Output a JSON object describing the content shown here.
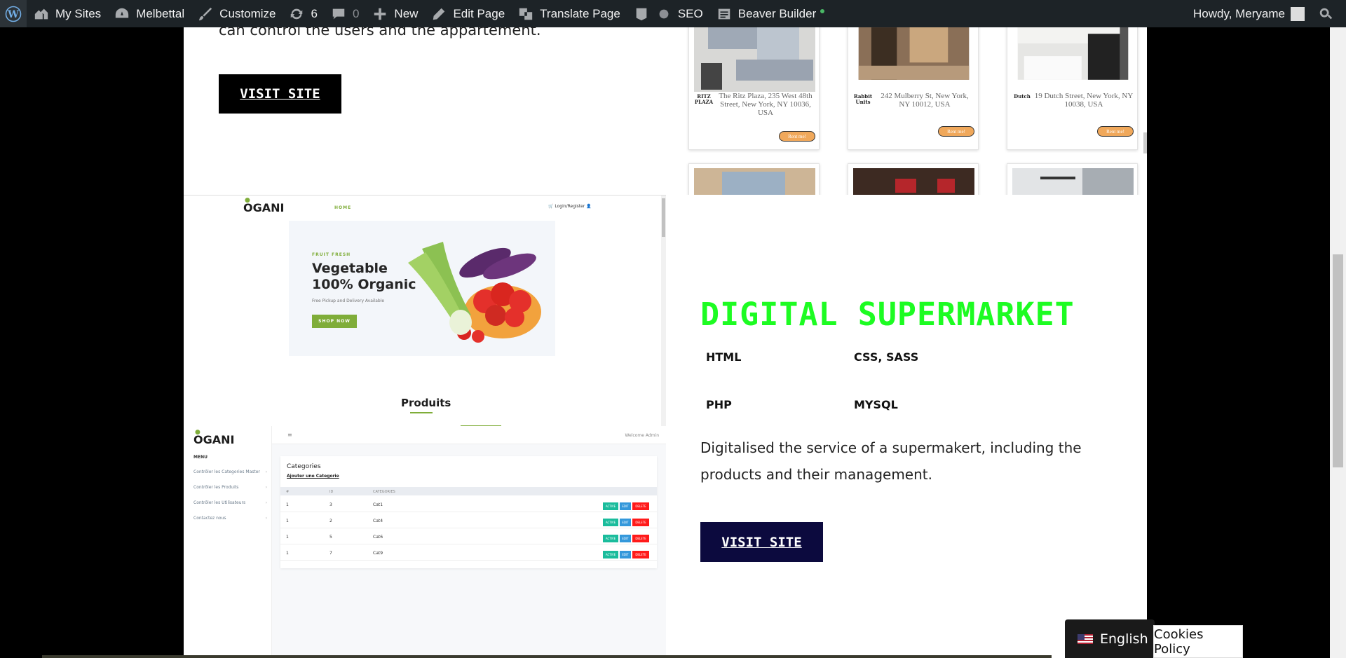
{
  "adminbar": {
    "items": [
      {
        "label": "My Sites"
      },
      {
        "label": "Melbettal"
      },
      {
        "label": "Customize"
      },
      {
        "label": "6"
      },
      {
        "label": "0"
      },
      {
        "label": "New"
      },
      {
        "label": "Edit Page"
      },
      {
        "label": "Translate Page"
      },
      {
        "label": "SEO"
      },
      {
        "label": "Beaver Builder"
      }
    ],
    "greeting": "Howdy, Meryame"
  },
  "top_section": {
    "partial_text": "can control the users and the appartement.",
    "visit_label": "VISIT SITE"
  },
  "apartments": [
    {
      "name": "RITZ PLAZA",
      "address": "The Ritz Plaza, 235 West 48th Street, New York, NY 10036, USA",
      "button": "Rent me!"
    },
    {
      "name": "Rabbit Units",
      "address": "242 Mulberry St, New York, NY 10012, USA",
      "button": "Rent me!"
    },
    {
      "name": "Dutch",
      "address": "19 Dutch Street, New York, NY 10038, USA",
      "button": "Rent me!"
    }
  ],
  "ogani": {
    "logo": "OGANI",
    "home": "HOME",
    "login": "Login/Register",
    "hero_tag": "FRUIT FRESH",
    "hero_title": "Vegetable 100% Organic",
    "hero_sub": "Free Pickup and Delivery Available",
    "hero_btn": "SHOP NOW",
    "section_title": "Produits"
  },
  "ogani_admin": {
    "logo": "OGANI",
    "welcome": "Welcome Admin",
    "menu_title": "MENU",
    "menu_items": [
      "Contrôler les Categories Master",
      "Contrôler les Produits",
      "Contrôler les Utilisateurs",
      "Contactez nous"
    ],
    "card_title": "Categories",
    "add_link": "Ajouter une Categorie",
    "headers": [
      "#",
      "ID",
      "CATEGORIES"
    ],
    "rows": [
      {
        "n": "1",
        "id": "3",
        "cat": "Cat1"
      },
      {
        "n": "1",
        "id": "2",
        "cat": "Cat4"
      },
      {
        "n": "1",
        "id": "5",
        "cat": "Cat6"
      },
      {
        "n": "1",
        "id": "7",
        "cat": "Cat9"
      }
    ],
    "actions": [
      "ACTIVE",
      "EDIT",
      "DELETE"
    ]
  },
  "project": {
    "title": "DIGITAL SUPERMARKET",
    "techs": [
      "HTML",
      "CSS, SASS",
      "PHP",
      "MYSQL"
    ],
    "description": "Digitalised the service of a supermakert, including the products and their management.",
    "visit_label": "VISIT SITE"
  },
  "footer": {
    "language": "English",
    "cookies": "Cookies Policy"
  },
  "colors": {
    "accent_green": "#1dfc22",
    "navy_button": "#0c0a3e",
    "ogani_green": "#7fad39",
    "adminbar": "#1d2327"
  },
  "icons": [
    "wordpress-icon",
    "my-sites-icon",
    "dashboard-icon",
    "customize-icon",
    "updates-icon",
    "comments-icon",
    "plus-icon",
    "edit-icon",
    "translate-icon",
    "yoast-icon",
    "beaver-icon",
    "search-icon"
  ]
}
